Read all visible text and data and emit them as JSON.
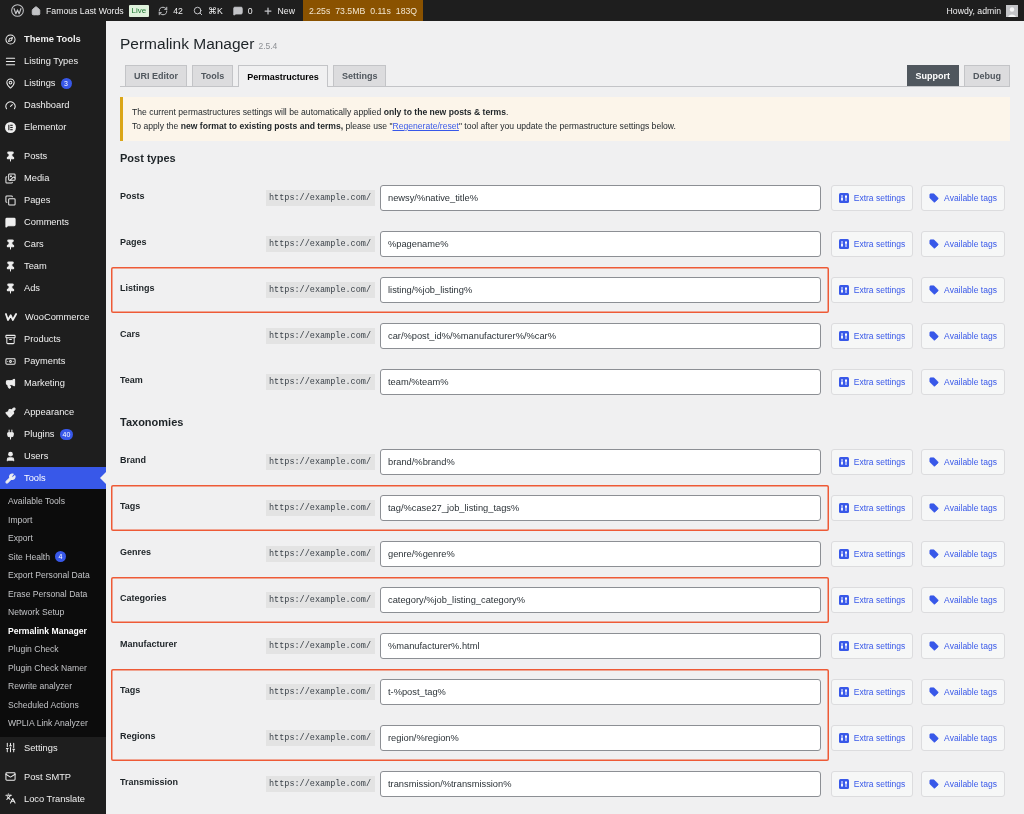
{
  "admin_bar": {
    "site_name": "Famous Last Words",
    "environment": "Live",
    "updates": "42",
    "search_shortcut": "⌘K",
    "comments": "0",
    "new_label": "New",
    "query_stats": [
      "2.25s",
      "73.5MB",
      "0.11s",
      "183Q"
    ],
    "greeting": "Howdy, admin"
  },
  "sidebar": {
    "groups": [
      {
        "items": [
          {
            "label": "Theme Tools",
            "bold": true,
            "selected": false
          },
          {
            "label": "Listing Types",
            "bold": false,
            "selected": false
          },
          {
            "label": "Listings",
            "badge": "3",
            "bold": false,
            "selected": false
          },
          {
            "label": "Dashboard",
            "bold": false,
            "selected": false
          },
          {
            "label": "Elementor",
            "bold": false,
            "selected": false
          }
        ]
      },
      {
        "items": [
          {
            "label": "Posts",
            "bold": false,
            "selected": false
          },
          {
            "label": "Media",
            "bold": false,
            "selected": false
          },
          {
            "label": "Pages",
            "bold": false,
            "selected": false
          },
          {
            "label": "Comments",
            "bold": false,
            "selected": false
          },
          {
            "label": "Cars",
            "bold": false,
            "selected": false
          },
          {
            "label": "Team",
            "bold": false,
            "selected": false
          },
          {
            "label": "Ads",
            "bold": false,
            "selected": false
          }
        ]
      },
      {
        "items": [
          {
            "label": "WooCommerce",
            "bold": false,
            "selected": false
          },
          {
            "label": "Products",
            "bold": false,
            "selected": false
          },
          {
            "label": "Payments",
            "bold": false,
            "selected": false
          },
          {
            "label": "Marketing",
            "bold": false,
            "selected": false
          }
        ]
      },
      {
        "items": [
          {
            "label": "Appearance",
            "bold": false,
            "selected": false
          },
          {
            "label": "Plugins",
            "badge": "40",
            "bold": false,
            "selected": false
          },
          {
            "label": "Users",
            "bold": false,
            "selected": false
          },
          {
            "label": "Tools",
            "bold": false,
            "selected": true,
            "submenu": [
              {
                "label": "Available Tools",
                "selected": false
              },
              {
                "label": "Import",
                "selected": false
              },
              {
                "label": "Export",
                "selected": false
              },
              {
                "label": "Site Health",
                "badge": "4",
                "selected": false
              },
              {
                "label": "Export Personal Data",
                "selected": false
              },
              {
                "label": "Erase Personal Data",
                "selected": false
              },
              {
                "label": "Network Setup",
                "selected": false
              },
              {
                "label": "Permalink Manager",
                "selected": true
              },
              {
                "label": "Plugin Check",
                "selected": false
              },
              {
                "label": "Plugin Check Namer",
                "selected": false
              },
              {
                "label": "Rewrite analyzer",
                "selected": false
              },
              {
                "label": "Scheduled Actions",
                "selected": false
              },
              {
                "label": "WPLIA Link Analyzer",
                "selected": false
              }
            ]
          },
          {
            "label": "Settings",
            "bold": false,
            "selected": false
          }
        ]
      },
      {
        "items": [
          {
            "label": "Post SMTP",
            "bold": false,
            "selected": false
          },
          {
            "label": "Loco Translate",
            "bold": false,
            "selected": false
          }
        ]
      }
    ]
  },
  "page": {
    "title": "Permalink Manager",
    "version": "2.5.4",
    "tabs": [
      {
        "label": "URI Editor",
        "selected": false
      },
      {
        "label": "Tools",
        "selected": false
      },
      {
        "label": "Permastructures",
        "selected": true
      },
      {
        "label": "Settings",
        "selected": false
      }
    ],
    "actions": [
      {
        "label": "Support",
        "kind": "primary"
      },
      {
        "label": "Debug",
        "kind": "secondary"
      }
    ],
    "notice": {
      "line_1": "The current permastructures settings will be automatically applied **only to the new posts & terms**.",
      "line_2": {
        "before": "To apply the **new format to existing posts and terms,** please use \"",
        "link": "Regenerate/reset",
        "after": "\" tool after you update the permastructure settings below."
      }
    },
    "sections": [
      {
        "heading": "Post types",
        "rows": [
          {
            "label": "Posts",
            "prefix": "https://example.com/",
            "value": "newsy/%native_title%",
            "buttons": [
              "Extra settings",
              "Available tags"
            ],
            "highlighted": false
          },
          {
            "label": "Pages",
            "prefix": "https://example.com/",
            "value": "%pagename%",
            "buttons": [
              "Extra settings",
              "Available tags"
            ],
            "highlighted": false
          },
          {
            "label": "Listings",
            "prefix": "https://example.com/",
            "value": "listing/%job_listing%",
            "buttons": [
              "Extra settings",
              "Available tags"
            ],
            "highlighted": true
          },
          {
            "label": "Cars",
            "prefix": "https://example.com/",
            "value": "car/%post_id%/%manufacturer%/%car%",
            "buttons": [
              "Extra settings",
              "Available tags"
            ],
            "highlighted": false
          },
          {
            "label": "Team",
            "prefix": "https://example.com/",
            "value": "team/%team%",
            "buttons": [
              "Extra settings",
              "Available tags"
            ],
            "highlighted": false
          }
        ]
      },
      {
        "heading": "Taxonomies",
        "rows": [
          {
            "label": "Brand",
            "prefix": "https://example.com/",
            "value": "brand/%brand%",
            "buttons": [
              "Extra settings",
              "Available tags"
            ],
            "highlighted": false
          },
          {
            "label": "Tags",
            "prefix": "https://example.com/",
            "value": "tag/%case27_job_listing_tags%",
            "buttons": [
              "Extra settings",
              "Available tags"
            ],
            "highlighted": true
          },
          {
            "label": "Genres",
            "prefix": "https://example.com/",
            "value": "genre/%genre%",
            "buttons": [
              "Extra settings",
              "Available tags"
            ],
            "highlighted": false
          },
          {
            "label": "Categories",
            "prefix": "https://example.com/",
            "value": "category/%job_listing_category%",
            "buttons": [
              "Extra settings",
              "Available tags"
            ],
            "highlighted": true
          },
          {
            "label": "Manufacturer",
            "prefix": "https://example.com/",
            "value": "%manufacturer%.html",
            "buttons": [
              "Extra settings",
              "Available tags"
            ],
            "highlighted": false
          },
          {
            "label": "Tags",
            "prefix": "https://example.com/",
            "value": "t-%post_tag%",
            "buttons": [
              "Extra settings",
              "Available tags"
            ],
            "highlighted": true
          },
          {
            "label": "Regions",
            "prefix": "https://example.com/",
            "value": "region/%region%",
            "buttons": [
              "Extra settings",
              "Available tags"
            ],
            "highlighted": true
          },
          {
            "label": "Transmission",
            "prefix": "https://example.com/",
            "value": "transmission/%transmission%",
            "buttons": [
              "Extra settings",
              "Available tags"
            ],
            "highlighted": false
          }
        ]
      }
    ]
  }
}
